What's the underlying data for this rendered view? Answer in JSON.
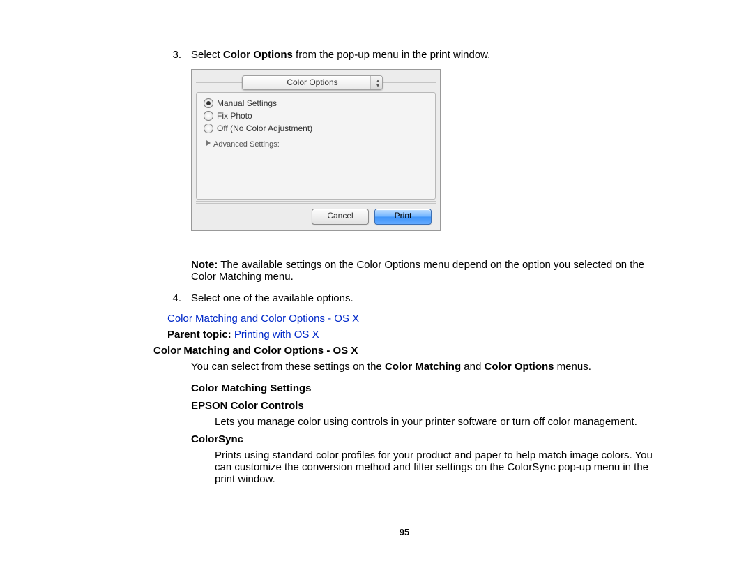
{
  "steps": {
    "s3": {
      "num": "3.",
      "pre": "Select ",
      "bold": "Color Options",
      "post": " from the pop-up menu in the print window."
    },
    "s4": {
      "num": "4.",
      "text": "Select one of the available options."
    }
  },
  "shot": {
    "dropdown": "Color Options",
    "radios": {
      "manual": "Manual Settings",
      "fix": "Fix Photo",
      "off": "Off (No Color Adjustment)"
    },
    "disclosure": "Advanced Settings:",
    "cancel": "Cancel",
    "print": "Print"
  },
  "note": {
    "label": "Note:",
    "text": " The available settings on the Color Options menu depend on the option you selected on the Color Matching menu."
  },
  "link1": "Color Matching and Color Options - OS X",
  "parent": {
    "label": "Parent topic:",
    "link": " Printing with OS X"
  },
  "heading": "Color Matching and Color Options - OS X",
  "intro": {
    "pre": "You can select from these settings on the ",
    "b1": "Color Matching",
    "mid": " and ",
    "b2": "Color Options",
    "post": " menus."
  },
  "cms_heading": "Color Matching Settings",
  "epson": {
    "title": "EPSON Color Controls",
    "desc": "Lets you manage color using controls in your printer software or turn off color management."
  },
  "colorsync": {
    "title": "ColorSync",
    "desc": "Prints using standard color profiles for your product and paper to help match image colors. You can customize the conversion method and filter settings on the ColorSync pop-up menu in the print window."
  },
  "page": "95"
}
